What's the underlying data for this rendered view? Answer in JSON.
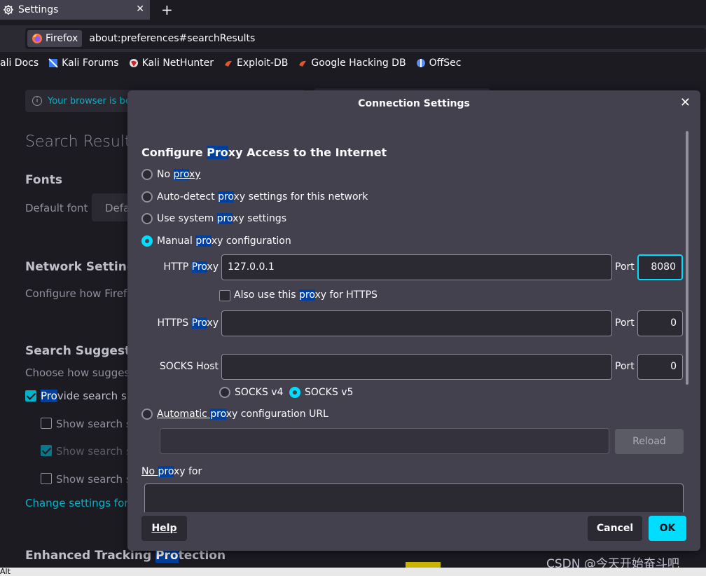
{
  "tab": {
    "title": "Settings",
    "close": "✕",
    "new_tab": "+"
  },
  "urlbar": {
    "identity": "Firefox",
    "url": "about:preferences#searchResults"
  },
  "bookmarks": [
    {
      "label": "ali Docs"
    },
    {
      "label": "Kali Forums"
    },
    {
      "label": "Kali NetHunter"
    },
    {
      "label": "Exploit-DB"
    },
    {
      "label": "Google Hacking DB"
    },
    {
      "label": "OffSec"
    }
  ],
  "prefs": {
    "notice": "Your browser is be",
    "heading": "Search Results",
    "fonts_heading": "Fonts",
    "default_font_label": "Default font",
    "default_font_value": "Defa",
    "network_heading": "Network Settings",
    "network_text": "Configure how Firefo",
    "suggest_heading": "Search Suggestio",
    "suggest_text": "Choose how suggest",
    "provide_pre": "Pro",
    "provide_post": "vide search su",
    "show1": "Show search s",
    "show2": "Show search s",
    "show3": "Show search s",
    "change_link": "Change settings for",
    "etp_pre": "Enhanced Tracking ",
    "etp_hl": "Pro",
    "etp_post": "tection"
  },
  "dialog": {
    "title": "Connection Settings",
    "close": "✕",
    "section": {
      "pre": "Configure ",
      "hl": "Pro",
      "post": "xy Access to the Internet"
    },
    "no_proxy": {
      "pre": "No ",
      "hl": "pro",
      "post": "xy"
    },
    "auto_detect": {
      "pre": "Auto-detect ",
      "hl": "pro",
      "post": "xy settings for this network"
    },
    "system": {
      "pre": "Use system ",
      "hl": "pro",
      "post": "xy settings"
    },
    "manual": {
      "pre": "Manual ",
      "hl": "pro",
      "post": "xy configuration"
    },
    "http_label": {
      "pre": "HTTP ",
      "hl": "Pro",
      "post": "xy"
    },
    "http_value": "127.0.0.1",
    "http_port": "8080",
    "also_https": {
      "pre": "Also use this ",
      "hl": "pro",
      "post": "xy for HTTPS"
    },
    "https_label": {
      "pre": "HTTPS ",
      "hl": "Pro",
      "post": "xy"
    },
    "https_value": "",
    "https_port": "0",
    "socks_label": "SOCKS Host",
    "socks_value": "",
    "socks_port": "0",
    "port_label": "Port",
    "socks_v4": "SOCKS v4",
    "socks_v5": "SOCKS v5",
    "auto_url": {
      "pre": "Automatic ",
      "hl": "pro",
      "post": "xy configuration URL"
    },
    "auto_url_value": "",
    "reload": "Reload",
    "no_proxy_for": {
      "pre": "No ",
      "hl": "pro",
      "post": "xy for"
    },
    "help": "Help",
    "cancel": "Cancel",
    "ok": "OK"
  },
  "watermark": "CSDN @今天开始奋斗吧",
  "bottom_text": "Alt"
}
